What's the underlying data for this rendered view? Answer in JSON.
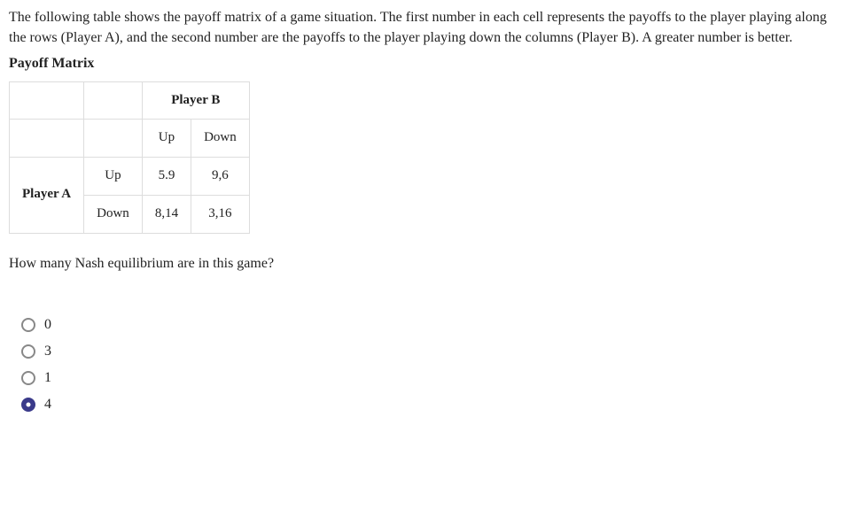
{
  "intro": "The following table shows the payoff matrix of a game situation. The first number in each cell represents the payoffs to the player playing along the rows (Player A), and the second number are the payoffs to the player playing down the columns (Player B). A greater number is better.",
  "matrix_title": "Payoff Matrix",
  "table": {
    "player_b_header": "Player B",
    "player_a_header": "Player A",
    "col_up": "Up",
    "col_down": "Down",
    "row_up": "Up",
    "row_down": "Down",
    "cell_up_up": "5.9",
    "cell_up_down": "9,6",
    "cell_down_up": "8,14",
    "cell_down_down": "3,16"
  },
  "question": "How many Nash equilibrium are in this game?",
  "options": [
    {
      "label": "0",
      "selected": false
    },
    {
      "label": "3",
      "selected": false
    },
    {
      "label": "1",
      "selected": false
    },
    {
      "label": "4",
      "selected": true
    }
  ],
  "chart_data": {
    "type": "table",
    "title": "Payoff Matrix",
    "row_player": "Player A",
    "column_player": "Player B",
    "row_labels": [
      "Up",
      "Down"
    ],
    "column_labels": [
      "Up",
      "Down"
    ],
    "cells": [
      [
        "5.9",
        "9,6"
      ],
      [
        "8,14",
        "3,16"
      ]
    ]
  }
}
